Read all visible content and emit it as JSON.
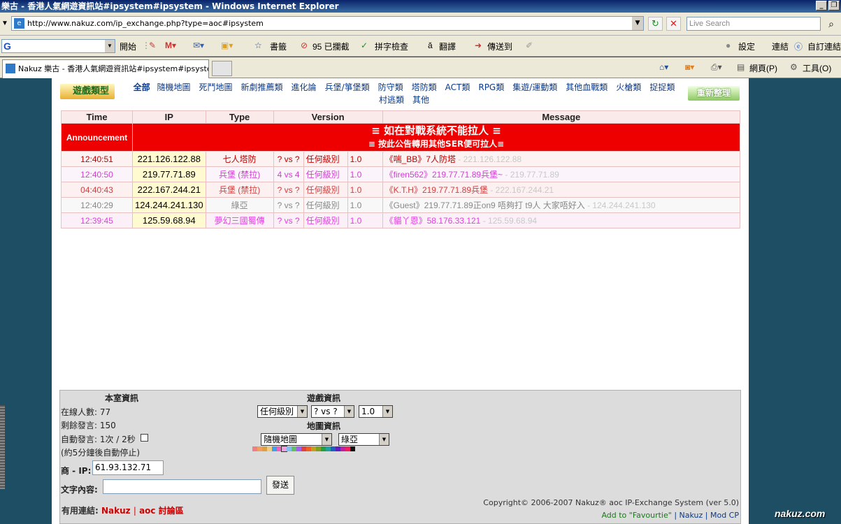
{
  "window": {
    "title": "樂古 - 香港人氣網遊資訊站#ipsystem#ipsystem - Windows Internet Explorer",
    "url": "http://www.nakuz.com/ip_exchange.php?type=aoc#ipsystem",
    "search_placeholder": "Live Search"
  },
  "toolbar": {
    "google_logo": "G",
    "go_label": "開始",
    "bookmarks_label": "書籤",
    "blocked_label": "95 已攔截",
    "spellcheck_label": "拼字檢查",
    "translate_label": "翻譯",
    "sendto_label": "傳送到",
    "settings_label": "設定",
    "links_label": "連結",
    "autolink_label": "自訂連結"
  },
  "tabbar": {
    "tab_title": "Nakuz 樂古 - 香港人氣網遊資訊站#ipsystem#ipsystem",
    "page_label": "網頁(P)",
    "tools_label": "工具(O)"
  },
  "categories": {
    "logo_label": "遊戲類型",
    "all_label": "全部",
    "items": [
      "隨機地圖",
      "死鬥地圖",
      "新劇推薦類",
      "進化論",
      "兵堡/箏堡類",
      "防守類",
      "塔防類",
      "ACT類",
      "RPG類",
      "集遊/運動類",
      "其他血戰類",
      "火槍類",
      "捉捉類",
      "村逃類",
      "其他"
    ],
    "refresh_label": "重新整理"
  },
  "table": {
    "headers": [
      "Time",
      "IP",
      "Type",
      "Version",
      "Message"
    ],
    "announcement_label": "Announcement",
    "announcement_line1": "≡ 如在對戰系統不能拉人 ≡",
    "announcement_line2": "≡ 按此公告轉用其他SER便可拉人≡",
    "rows": [
      {
        "time": "12:40:51",
        "ip": "221.126.122.88",
        "type": "七人塔防",
        "vs": "? vs ?",
        "level": "任何級別",
        "version": "1.0",
        "message": "《喘_BB》7人防塔",
        "msg_ip": " - 221.126.122.88",
        "color": "#c00000"
      },
      {
        "time": "12:40:50",
        "ip": "219.77.71.89",
        "type": "兵堡 (禁拉)",
        "vs": "4 vs 4",
        "level": "任何級別",
        "version": "1.0",
        "message": "《firen562》219.77.71.89兵堡~",
        "msg_ip": " - 219.77.71.89",
        "color": "#d040d0"
      },
      {
        "time": "04:40:43",
        "ip": "222.167.244.21",
        "type": "兵堡 (禁拉)",
        "vs": "? vs ?",
        "level": "任何級別",
        "version": "1.0",
        "message": "《K.T.H》219.77.71.89兵堡",
        "msg_ip": " - 222.167.244.21",
        "color": "#d04040"
      },
      {
        "time": "12:40:29",
        "ip": "124.244.241.130",
        "type": "綠亞",
        "vs": "? vs ?",
        "level": "任何級別",
        "version": "1.0",
        "message": "《Guest》219.77.71.89正on9 唔夠打 t9人 大家唔好入",
        "msg_ip": " - 124.244.241.130",
        "color": "#888888"
      },
      {
        "time": "12:39:45",
        "ip": "125.59.68.94",
        "type": "夢幻三國蜀傳",
        "vs": "? vs ?",
        "level": "任何級別",
        "version": "1.0",
        "message": "《貓丫恩》58.176.33.121",
        "msg_ip": " - 125.59.68.94",
        "color": "#e040e0"
      }
    ]
  },
  "panel": {
    "room_title": "本室資訊",
    "online_label": "在線人數: 77",
    "remaining_label": "剩餘發言: 150",
    "auto_label": "自動發言: 1次 / 2秒",
    "auto_note": "(約5分鐘後自動停止)",
    "ip_label": "商 - IP:",
    "ip_value": "61.93.132.71",
    "text_label": "文字內容:",
    "send_label": "發送",
    "game_title": "遊戲資訊",
    "level_select": "任何級別",
    "vs_select": "? vs ?",
    "version_select": "1.0",
    "map_title": "地圖資訊",
    "map_select": "隨機地圖",
    "map2_select": "綠亞",
    "useful_label": "有用連結:",
    "link_nakuz": "Nakuz",
    "link_forum": "aoc 討論區",
    "copyright": "Copyright© 2006-2007  Nakuz® aoc IP-Exchange System (ver 5.0)",
    "fav_link": "Add to \"Favourtie\"",
    "nakuz_link": "Nakuz",
    "modcp_link": "Mod CP",
    "palette": [
      "#f08080",
      "#f0a060",
      "#e0a040",
      "#f0d080",
      "#40a0f0",
      "#f060c0",
      "#f0a0e0",
      "#80c0f0",
      "#60c060",
      "#a060f0",
      "#e04040",
      "#f06020",
      "#c0a020",
      "#80a020",
      "#20a040",
      "#20a0a0",
      "#2060c0",
      "#6020c0",
      "#c020a0",
      "#f02060",
      "#101010"
    ]
  },
  "watermark": "nakuz.com"
}
